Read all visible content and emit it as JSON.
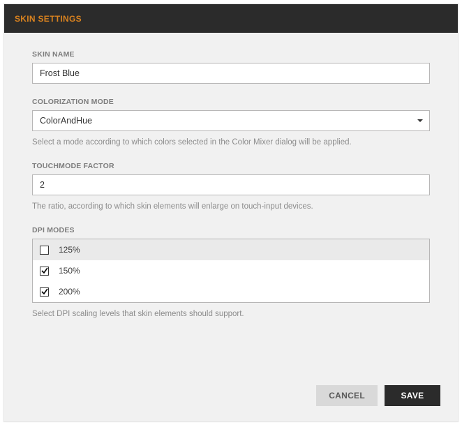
{
  "header": {
    "title": "SKIN SETTINGS"
  },
  "skinName": {
    "label": "SKIN NAME",
    "value": "Frost Blue"
  },
  "colorizationMode": {
    "label": "COLORIZATION MODE",
    "value": "ColorAndHue",
    "hint": "Select a mode according to which colors selected in the Color Mixer dialog will be applied."
  },
  "touchFactor": {
    "label": "TOUCHMODE FACTOR",
    "value": "2",
    "hint": "The ratio, according to which skin elements will enlarge on touch-input devices."
  },
  "dpiModes": {
    "label": "DPI MODES",
    "hint": "Select DPI scaling levels that skin elements should support.",
    "items": [
      {
        "label": "125%",
        "checked": false
      },
      {
        "label": "150%",
        "checked": true
      },
      {
        "label": "200%",
        "checked": true
      }
    ]
  },
  "buttons": {
    "cancel": "CANCEL",
    "save": "SAVE"
  }
}
